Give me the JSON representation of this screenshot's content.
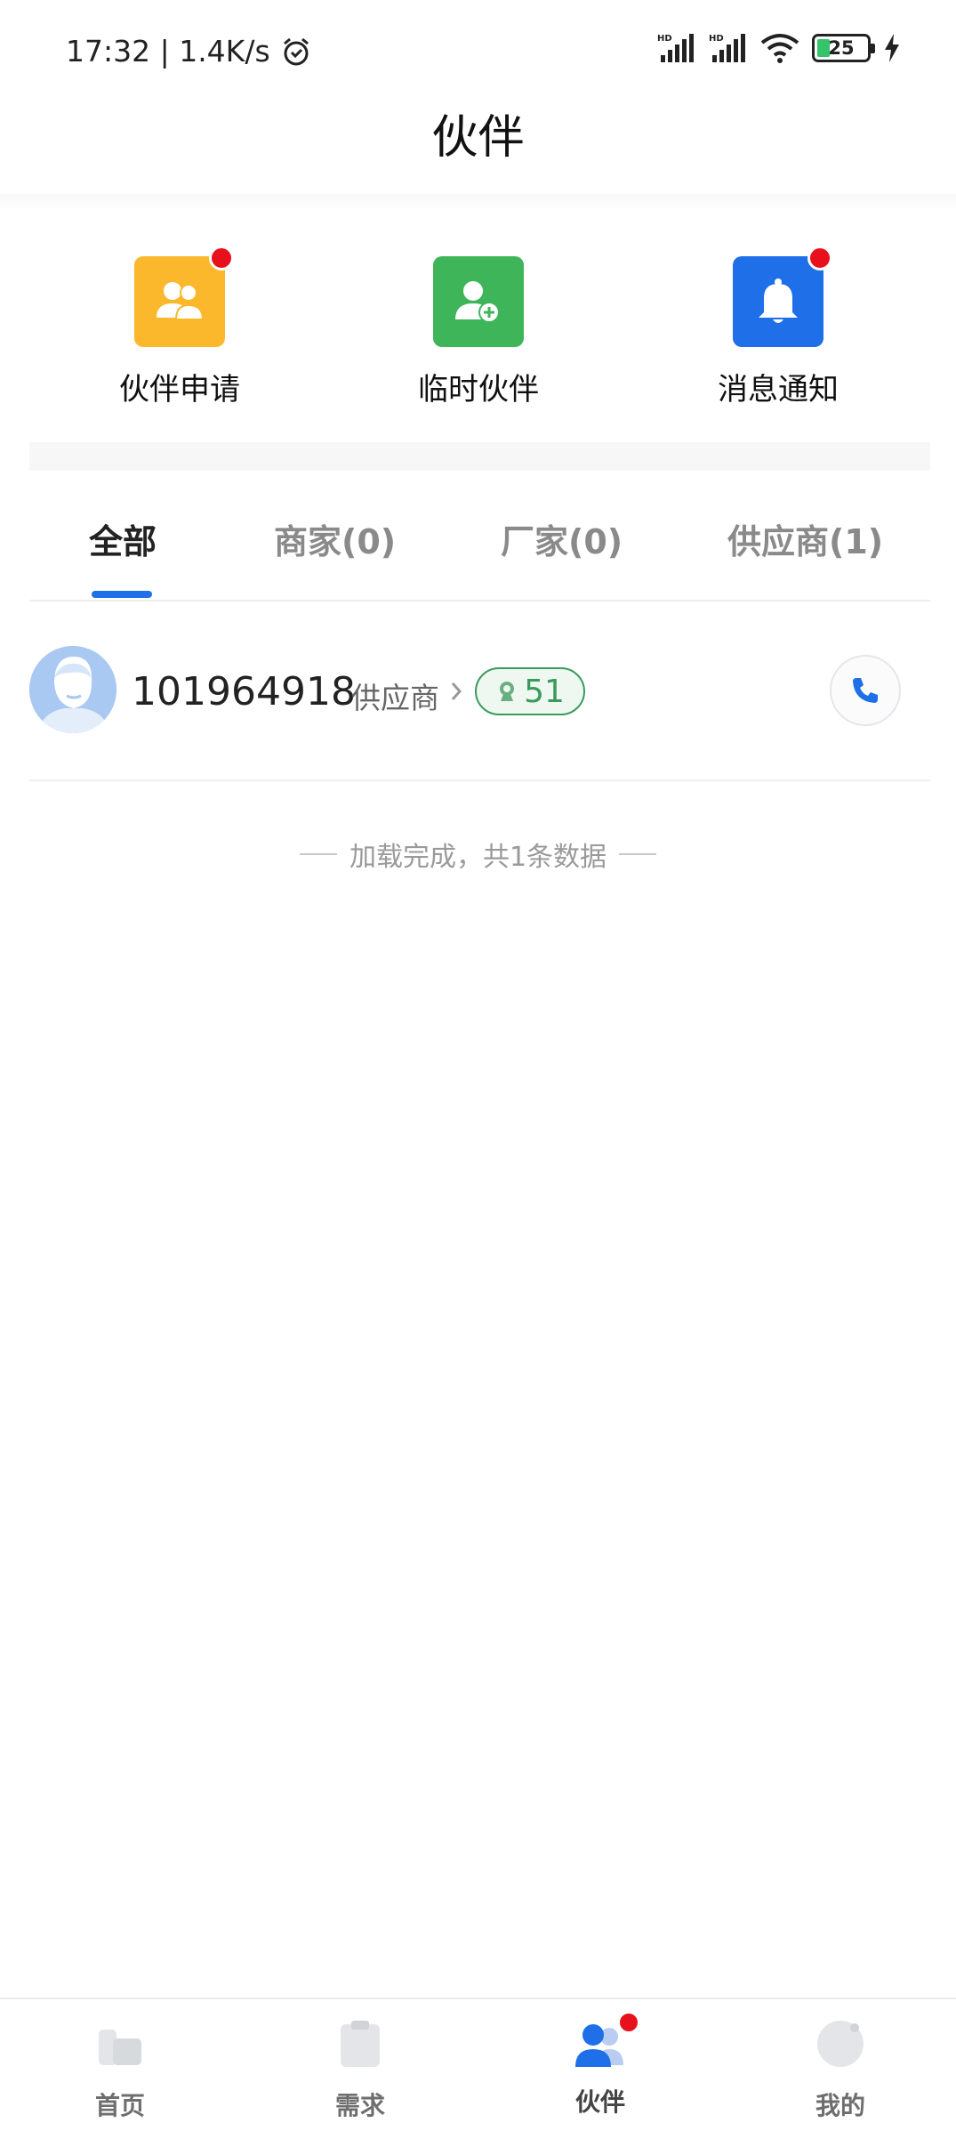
{
  "status": {
    "time_speed": "17:32 | 1.4K/s",
    "signal1": "HD",
    "signal2": "HD",
    "battery": "25"
  },
  "header": {
    "title": "伙伴"
  },
  "quick_actions": [
    {
      "label": "伙伴申请",
      "color": "#fcb82c",
      "has_dot": true
    },
    {
      "label": "临时伙伴",
      "color": "#3fb55a",
      "has_dot": false
    },
    {
      "label": "消息通知",
      "color": "#1e6fe8",
      "has_dot": true
    }
  ],
  "tabs": [
    {
      "label": "全部",
      "active": true
    },
    {
      "label": "商家(0)",
      "active": false
    },
    {
      "label": "厂家(0)",
      "active": false
    },
    {
      "label": "供应商(1)",
      "active": false
    }
  ],
  "list": [
    {
      "id": "101964918",
      "type": "供应商",
      "badge_value": "51"
    }
  ],
  "footer_note": "加载完成，共1条数据",
  "bottom_nav": [
    {
      "label": "首页",
      "icon": "home-icon",
      "active": false
    },
    {
      "label": "需求",
      "icon": "clipboard-icon",
      "active": false
    },
    {
      "label": "伙伴",
      "icon": "partners-icon",
      "active": true,
      "has_dot": true
    },
    {
      "label": "我的",
      "icon": "profile-icon",
      "active": false
    }
  ],
  "colors": {
    "accent": "#1e6fe8",
    "badge_green": "#3a9a5b",
    "notify_red": "#e8101a"
  }
}
